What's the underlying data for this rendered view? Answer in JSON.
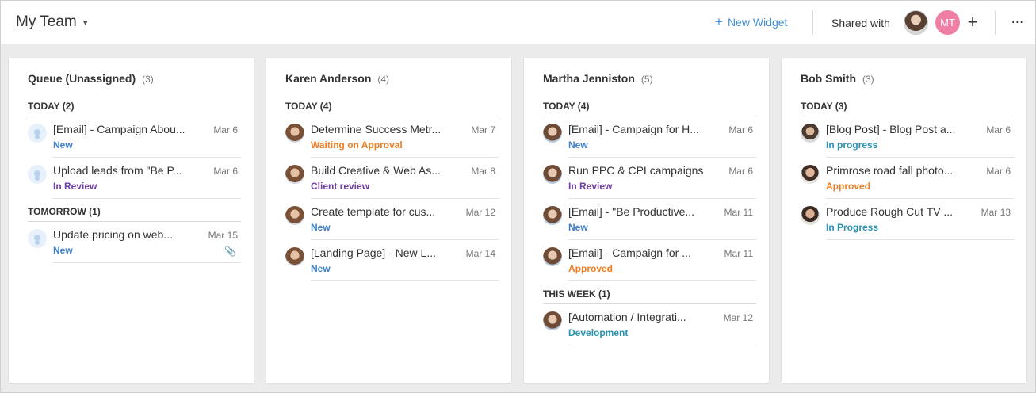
{
  "header": {
    "title": "My Team",
    "new_widget_label": "New Widget",
    "shared_with_label": "Shared with",
    "shared_avatar_initials": "MT",
    "more_icon": "⋯"
  },
  "columns": [
    {
      "name": "Queue (Unassigned)",
      "count": "(3)",
      "groups": [
        {
          "label": "TODAY (2)",
          "tasks": [
            {
              "title": "[Email] - Campaign Abou...",
              "date": "Mar 6",
              "status": "New"
            },
            {
              "title": "Upload leads from \"Be P...",
              "date": "Mar 6",
              "status": "In Review"
            }
          ]
        },
        {
          "label": "TOMORROW (1)",
          "tasks": [
            {
              "title": "Update pricing on web...",
              "date": "Mar 15",
              "status": "New",
              "attachment": "📎"
            }
          ]
        }
      ]
    },
    {
      "name": "Karen Anderson",
      "count": "(4)",
      "groups": [
        {
          "label": "TODAY (4)",
          "tasks": [
            {
              "title": "Determine Success Metr...",
              "date": "Mar 7",
              "status": "Waiting on Approval"
            },
            {
              "title": "Build Creative & Web As...",
              "date": "Mar 8",
              "status": "Client review"
            },
            {
              "title": "Create template for cus...",
              "date": "Mar 12",
              "status": "New"
            },
            {
              "title": "[Landing Page] - New L...",
              "date": "Mar 14",
              "status": "New"
            }
          ]
        }
      ]
    },
    {
      "name": "Martha Jenniston",
      "count": "(5)",
      "groups": [
        {
          "label": "TODAY (4)",
          "tasks": [
            {
              "title": "[Email] - Campaign for H...",
              "date": "Mar 6",
              "status": "New"
            },
            {
              "title": "Run PPC & CPI campaigns",
              "date": "Mar 6",
              "status": "In Review"
            },
            {
              "title": "[Email] - \"Be Productive...",
              "date": "Mar 11",
              "status": "New"
            },
            {
              "title": "[Email] - Campaign for ...",
              "date": "Mar 11",
              "status": "Approved"
            }
          ]
        },
        {
          "label": "THIS WEEK (1)",
          "tasks": [
            {
              "title": "[Automation / Integrati...",
              "date": "Mar 12",
              "status": "Development"
            }
          ]
        }
      ]
    },
    {
      "name": "Bob Smith",
      "count": "(3)",
      "groups": [
        {
          "label": "TODAY (3)",
          "tasks": [
            {
              "title": "[Blog Post] - Blog Post a...",
              "date": "Mar 6",
              "status": "In progress"
            },
            {
              "title": "Primrose road fall photo...",
              "date": "Mar 6",
              "status": "Approved"
            },
            {
              "title": "Produce Rough Cut TV ...",
              "date": "Mar 13",
              "status": "In Progress"
            }
          ]
        }
      ]
    }
  ],
  "colors": {
    "status_new": "#3d7fc9",
    "status_review": "#6f3fa7",
    "status_orange": "#f07f24",
    "status_teal": "#2a93b3",
    "accent_link": "#3d8fd9",
    "avatar_mt": "#f07fa6"
  }
}
